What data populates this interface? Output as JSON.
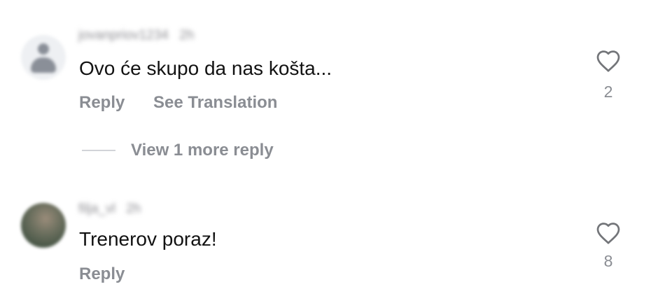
{
  "comments": [
    {
      "username": "jovanpriov1234",
      "time": "2h",
      "text": "Ovo će skupo da nas košta...",
      "reply_label": "Reply",
      "translate_label": "See Translation",
      "likes": "2",
      "avatar_icon": "default-user-avatar"
    },
    {
      "username": "filja_vl",
      "time": "2h",
      "text": "Trenerov poraz!",
      "reply_label": "Reply",
      "likes": "8",
      "avatar_icon": "user-photo-avatar"
    }
  ],
  "more_replies_label": "View 1 more reply",
  "colors": {
    "text": "#121212",
    "secondary": "#8a8d93",
    "divider": "#d2d4d8",
    "background": "#ffffff"
  }
}
